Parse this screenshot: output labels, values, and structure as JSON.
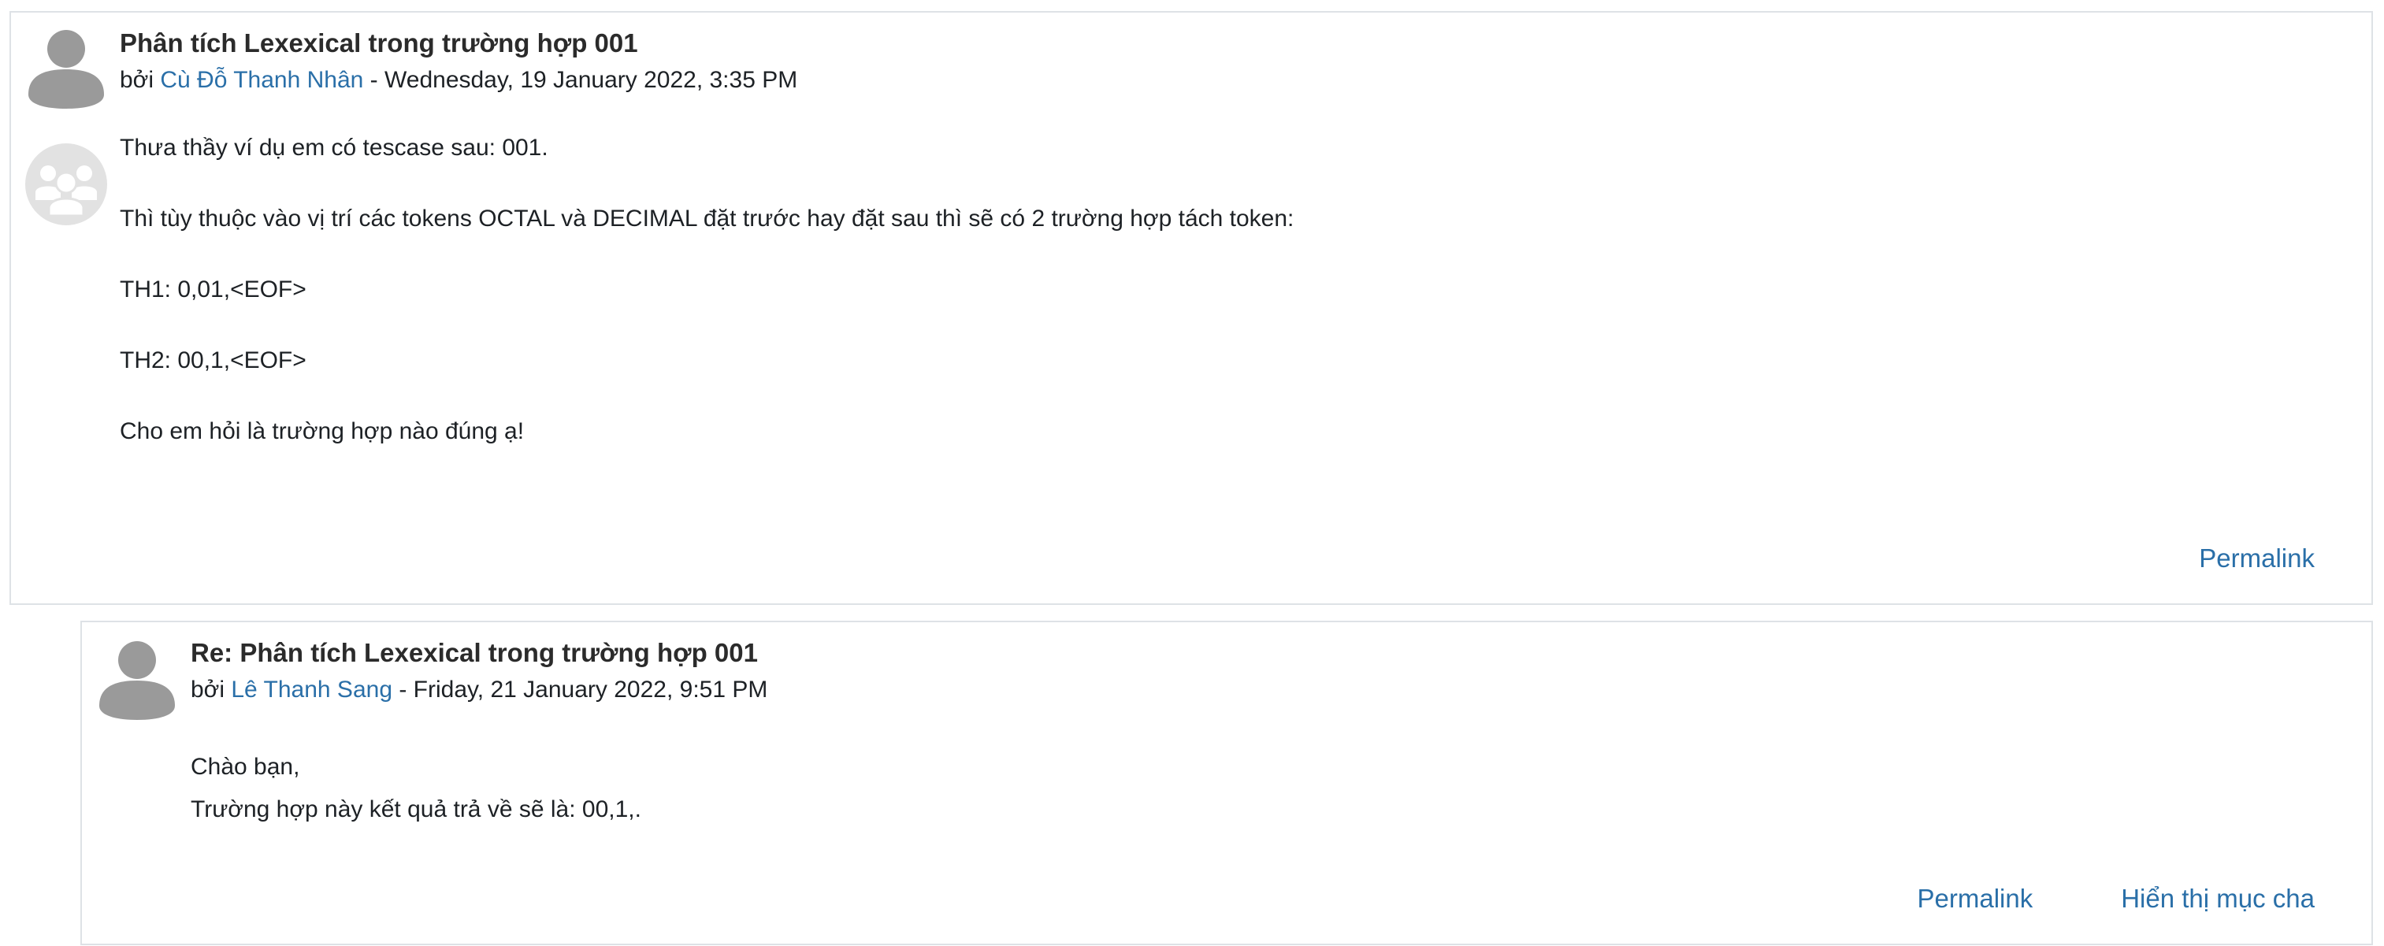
{
  "posts": [
    {
      "subject": "Phân tích Lexexical trong trường hợp 001",
      "by_prefix": "bởi",
      "author": "Cù Đỗ Thanh Nhân",
      "date": " - Wednesday, 19 January 2022, 3:35 PM",
      "paragraphs": [
        "Thưa thầy ví dụ em có tescase sau: 001.",
        "Thì tùy thuộc vào vị trí các tokens OCTAL và DECIMAL đặt trước hay đặt sau thì sẽ có 2 trường hợp tách token:",
        "TH1: 0,01,<EOF>",
        "TH2: 00,1,<EOF>",
        "Cho em hỏi là trường hợp nào đúng ạ!"
      ],
      "commands": {
        "permalink": "Permalink"
      }
    },
    {
      "subject": "Re: Phân tích Lexexical trong trường hợp 001",
      "by_prefix": "bởi",
      "author": "Lê Thanh Sang",
      "date": " - Friday, 21 January 2022, 9:51 PM",
      "paragraphs": [
        "Chào bạn,",
        "Trường hợp này kết quả trả về sẽ là: 00,1,."
      ],
      "commands": {
        "permalink": "Permalink",
        "show_parent": "Hiển thị mục cha"
      }
    }
  ],
  "icons": {
    "user_avatar": "user-avatar-icon",
    "group_avatar": "group-icon"
  },
  "colors": {
    "link": "#2a6fa8",
    "border": "#dee2e6",
    "avatar": "#9a9a9a",
    "group_bg": "#e2e2e2"
  }
}
